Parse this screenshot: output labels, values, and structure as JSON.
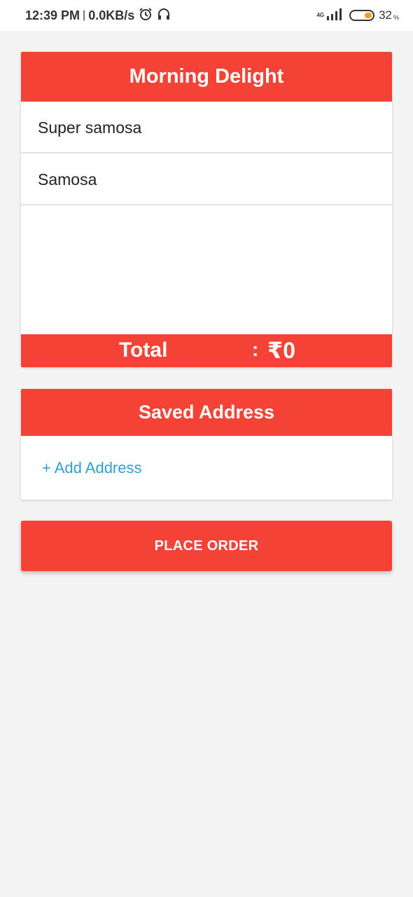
{
  "status_bar": {
    "time": "12:39 PM",
    "separator": "|",
    "speed": "0.0KB/s",
    "network": "4G",
    "battery": "32",
    "battery_unit": "%",
    "icons": [
      "alarm-icon",
      "headphones-icon",
      "signal-icon",
      "battery-icon"
    ]
  },
  "order": {
    "shop_name": "Morning Delight",
    "items": [
      "Super samosa",
      "Samosa"
    ],
    "total_label": "Total",
    "total_colon": ":",
    "total_value": "₹0"
  },
  "address": {
    "header": "Saved Address",
    "add_label": "+ Add Address"
  },
  "actions": {
    "place_order": "PLACE ORDER"
  },
  "colors": {
    "accent": "#f44336",
    "link": "#2f9fd8",
    "background": "#f3f3f3"
  }
}
